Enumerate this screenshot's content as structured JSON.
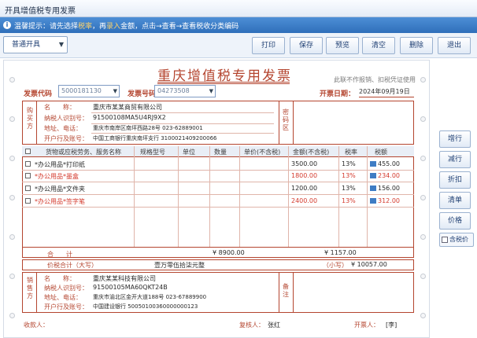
{
  "window": {
    "title": "开具增值税专用发票"
  },
  "tip": {
    "pre": "温馨提示：请先选择",
    "hl1": "税率",
    "mid1": "，再",
    "hl2": "录入",
    "post": "金额，点击→查看→查看税收分类编码"
  },
  "toolbar": {
    "select_value": "普通开具",
    "buttons": [
      "打印",
      "保存",
      "预览",
      "清空",
      "删除",
      "退出"
    ]
  },
  "side_buttons": [
    "增行",
    "减行",
    "折扣",
    "清单",
    "价格"
  ],
  "side_check": "含税价",
  "invoice": {
    "title": "重庆增值税专用发票",
    "code_label": "发票代码",
    "code_value": "5000181130",
    "number_label": "发票号码",
    "number_value": "04273508",
    "note_top": "此联不作报销、扣税凭证使用",
    "date_label": "开票日期：",
    "date_value": "2024年09月19日",
    "buyer": {
      "side_label": "购买方",
      "fields": [
        {
          "label": "名　　称：",
          "value": "重庆市某某商贸有限公司"
        },
        {
          "label": "纳税人识别号：",
          "value": "91500108MA5U4RJ9X2"
        },
        {
          "label": "地址、电话：",
          "value": "重庆市南岸区南坪西路28号 023-62889001"
        },
        {
          "label": "开户行及账号：",
          "value": "中国工商银行重庆南坪支行 3100021409200066"
        }
      ],
      "pwd_label": "密码区"
    },
    "columns": [
      "货物或应税劳务、服务名称",
      "规格型号",
      "单位",
      "数量",
      "单价(不含税)",
      "金额(不含税)",
      "税率",
      "税额"
    ],
    "items": [
      {
        "name": "*办公用品*打印纸",
        "amount": "3500.00",
        "rate": "13%",
        "tax": "455.00",
        "red": false
      },
      {
        "name": "*办公用品*墨盒",
        "amount": "1800.00",
        "rate": "13%",
        "tax": "234.00",
        "red": true
      },
      {
        "name": "*办公用品*文件夹",
        "amount": "1200.00",
        "rate": "13%",
        "tax": "156.00",
        "red": false
      },
      {
        "name": "*办公用品*签字笔",
        "amount": "2400.00",
        "rate": "13%",
        "tax": "312.00",
        "red": true
      }
    ],
    "total_label": "合　　计",
    "total_amount": "¥ 8900.00",
    "total_tax": "¥ 1157.00",
    "grand_label": "价税合计（大写）",
    "grand_caps": "壹万零伍拾柒元整",
    "grand_small_label": "（小写）",
    "grand_small": "¥ 10057.00",
    "seller": {
      "side_label": "销售方",
      "fields": [
        {
          "label": "名　　称：",
          "value": "重庆某某科技有限公司"
        },
        {
          "label": "纳税人识别号：",
          "value": "91500105MA60QKT24B"
        },
        {
          "label": "地址、电话：",
          "value": "重庆市渝北区金开大道188号 023-67889900"
        },
        {
          "label": "开户行及账号：",
          "value": "中国建设银行 50050100360000000123"
        }
      ],
      "remark_label": "备注"
    },
    "payee_label": "收款人：",
    "reviewer_label": "复核人：",
    "reviewer_value": "张红",
    "issuer_label": "开票人：",
    "issuer_value": "[李]"
  }
}
